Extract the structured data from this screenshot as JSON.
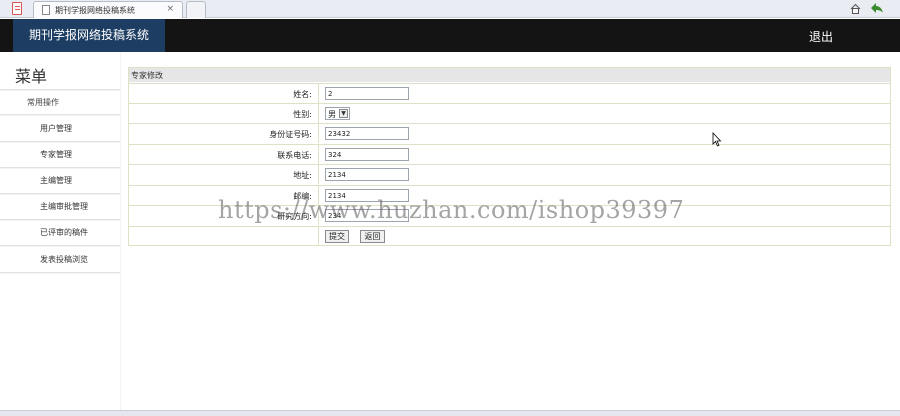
{
  "browser": {
    "tab_title": "期刊学报网络投稿系统",
    "tab_close": "×"
  },
  "header": {
    "app_title": "期刊学报网络投稿系统",
    "logout_label": "退出"
  },
  "sidebar": {
    "menu_title": "菜单",
    "group_label": "常用操作",
    "items": [
      {
        "label": "用户管理"
      },
      {
        "label": "专家管理"
      },
      {
        "label": "主编管理"
      },
      {
        "label": "主编审批管理"
      },
      {
        "label": "已评审的稿件"
      },
      {
        "label": "发表投稿浏览"
      }
    ]
  },
  "form": {
    "title": "专家修改",
    "rows": [
      {
        "label": "姓名:",
        "value": "2"
      },
      {
        "label": "性别:",
        "value": "男"
      },
      {
        "label": "身份证号码:",
        "value": "23432"
      },
      {
        "label": "联系电话:",
        "value": "324"
      },
      {
        "label": "地址:",
        "value": "2134"
      },
      {
        "label": "邮编:",
        "value": "2134"
      },
      {
        "label": "研究方向:",
        "value": "234"
      }
    ],
    "submit_label": "提交",
    "back_label": "返回"
  },
  "watermark": "https://www.huzhan.com/ishop39397",
  "colors": {
    "header_bg": "#141414",
    "title_box_bg": "#1d3d63",
    "panel_border": "#dde2c6"
  }
}
